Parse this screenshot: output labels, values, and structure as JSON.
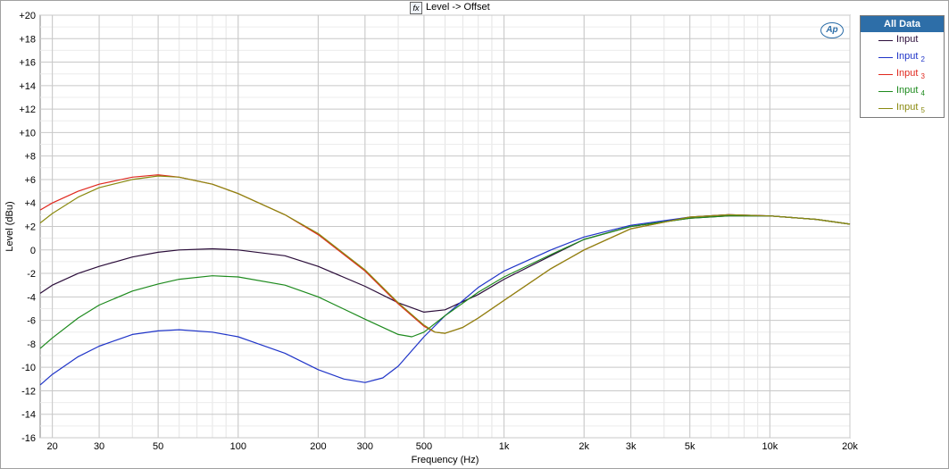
{
  "title": "Level -> Offset",
  "title_icon": "function-icon",
  "logo_text": "Ap",
  "legend": {
    "header": "All Data",
    "items": [
      {
        "label": "Input",
        "sub": "",
        "color": "#2b0d3a"
      },
      {
        "label": "Input",
        "sub": "2",
        "color": "#1f34c8"
      },
      {
        "label": "Input",
        "sub": "3",
        "color": "#e0281e"
      },
      {
        "label": "Input",
        "sub": "4",
        "color": "#1d8a1d"
      },
      {
        "label": "Input",
        "sub": "5",
        "color": "#8a8a10"
      }
    ]
  },
  "chart_data": {
    "type": "line",
    "xlabel": "Frequency (Hz)",
    "ylabel": "Level (dBu)",
    "x_scale": "log",
    "xlim": [
      18,
      20000
    ],
    "ylim": [
      -16,
      20
    ],
    "grid": true,
    "legend_position": "right",
    "x_ticks": [
      {
        "value": 20,
        "label": "20"
      },
      {
        "value": 30,
        "label": "30"
      },
      {
        "value": 50,
        "label": "50"
      },
      {
        "value": 100,
        "label": "100"
      },
      {
        "value": 200,
        "label": "200"
      },
      {
        "value": 300,
        "label": "300"
      },
      {
        "value": 500,
        "label": "500"
      },
      {
        "value": 1000,
        "label": "1k"
      },
      {
        "value": 2000,
        "label": "2k"
      },
      {
        "value": 3000,
        "label": "3k"
      },
      {
        "value": 5000,
        "label": "5k"
      },
      {
        "value": 10000,
        "label": "10k"
      },
      {
        "value": 20000,
        "label": "20k"
      }
    ],
    "y_ticks": [
      {
        "value": 20,
        "label": "+20"
      },
      {
        "value": 18,
        "label": "+18"
      },
      {
        "value": 16,
        "label": "+16"
      },
      {
        "value": 14,
        "label": "+14"
      },
      {
        "value": 12,
        "label": "+12"
      },
      {
        "value": 10,
        "label": "+10"
      },
      {
        "value": 8,
        "label": "+8"
      },
      {
        "value": 6,
        "label": "+6"
      },
      {
        "value": 4,
        "label": "+4"
      },
      {
        "value": 2,
        "label": "+2"
      },
      {
        "value": 0,
        "label": "0"
      },
      {
        "value": -2,
        "label": "-2"
      },
      {
        "value": -4,
        "label": "-4"
      },
      {
        "value": -6,
        "label": "-6"
      },
      {
        "value": -8,
        "label": "-8"
      },
      {
        "value": -10,
        "label": "-10"
      },
      {
        "value": -12,
        "label": "-12"
      },
      {
        "value": -14,
        "label": "-14"
      },
      {
        "value": -16,
        "label": "-16"
      }
    ],
    "series": [
      {
        "name": "Input",
        "color": "#2b0d3a",
        "x": [
          18,
          20,
          25,
          30,
          40,
          50,
          60,
          80,
          100,
          150,
          200,
          300,
          400,
          500,
          600,
          800,
          1000,
          1500,
          2000,
          3000,
          5000,
          7000,
          10000,
          15000,
          20000
        ],
        "y": [
          -3.7,
          -3.0,
          -2.0,
          -1.4,
          -0.6,
          -0.2,
          0.0,
          0.1,
          0.0,
          -0.5,
          -1.4,
          -3.1,
          -4.5,
          -5.3,
          -5.1,
          -3.8,
          -2.5,
          -0.5,
          0.9,
          2.0,
          2.7,
          2.9,
          2.9,
          2.6,
          2.2
        ]
      },
      {
        "name": "Input 2",
        "color": "#1f34c8",
        "x": [
          18,
          20,
          25,
          30,
          40,
          50,
          60,
          80,
          100,
          150,
          200,
          250,
          300,
          350,
          400,
          500,
          600,
          800,
          1000,
          1500,
          2000,
          3000,
          5000,
          7000,
          10000,
          15000,
          20000
        ],
        "y": [
          -11.5,
          -10.6,
          -9.1,
          -8.2,
          -7.2,
          -6.9,
          -6.8,
          -7.0,
          -7.4,
          -8.8,
          -10.2,
          -11.0,
          -11.3,
          -10.9,
          -9.9,
          -7.4,
          -5.6,
          -3.2,
          -1.8,
          0.0,
          1.1,
          2.1,
          2.8,
          3.0,
          2.9,
          2.6,
          2.2
        ]
      },
      {
        "name": "Input 3",
        "color": "#e0281e",
        "x": [
          18,
          20,
          25,
          30,
          40,
          50,
          60,
          80,
          100,
          150,
          200,
          300,
          400,
          500,
          550,
          600,
          700,
          800,
          1000,
          1500,
          2000,
          3000,
          5000,
          7000,
          10000,
          15000,
          20000
        ],
        "y": [
          3.4,
          4.0,
          5.0,
          5.6,
          6.2,
          6.4,
          6.2,
          5.6,
          4.8,
          3.0,
          1.3,
          -1.8,
          -4.6,
          -6.5,
          -7.0,
          -7.1,
          -6.6,
          -5.8,
          -4.3,
          -1.6,
          0.0,
          1.8,
          2.8,
          3.0,
          2.9,
          2.6,
          2.2
        ]
      },
      {
        "name": "Input 4",
        "color": "#1d8a1d",
        "x": [
          18,
          20,
          25,
          30,
          40,
          50,
          60,
          80,
          100,
          150,
          200,
          300,
          400,
          450,
          500,
          600,
          800,
          1000,
          1500,
          2000,
          3000,
          5000,
          7000,
          10000,
          15000,
          20000
        ],
        "y": [
          -8.4,
          -7.5,
          -5.8,
          -4.7,
          -3.5,
          -2.9,
          -2.5,
          -2.2,
          -2.3,
          -3.0,
          -4.0,
          -5.9,
          -7.2,
          -7.4,
          -7.0,
          -5.6,
          -3.6,
          -2.3,
          -0.4,
          0.9,
          2.0,
          2.7,
          2.9,
          2.9,
          2.6,
          2.2
        ]
      },
      {
        "name": "Input 5",
        "color": "#8a8a10",
        "x": [
          18,
          20,
          25,
          30,
          40,
          50,
          60,
          80,
          100,
          150,
          200,
          300,
          400,
          500,
          550,
          600,
          700,
          800,
          1000,
          1500,
          2000,
          3000,
          5000,
          7000,
          10000,
          15000,
          20000
        ],
        "y": [
          2.3,
          3.1,
          4.5,
          5.3,
          6.0,
          6.3,
          6.2,
          5.6,
          4.8,
          3.0,
          1.4,
          -1.7,
          -4.5,
          -6.4,
          -7.0,
          -7.1,
          -6.6,
          -5.8,
          -4.3,
          -1.6,
          0.0,
          1.8,
          2.8,
          3.0,
          2.9,
          2.6,
          2.2
        ]
      }
    ]
  }
}
